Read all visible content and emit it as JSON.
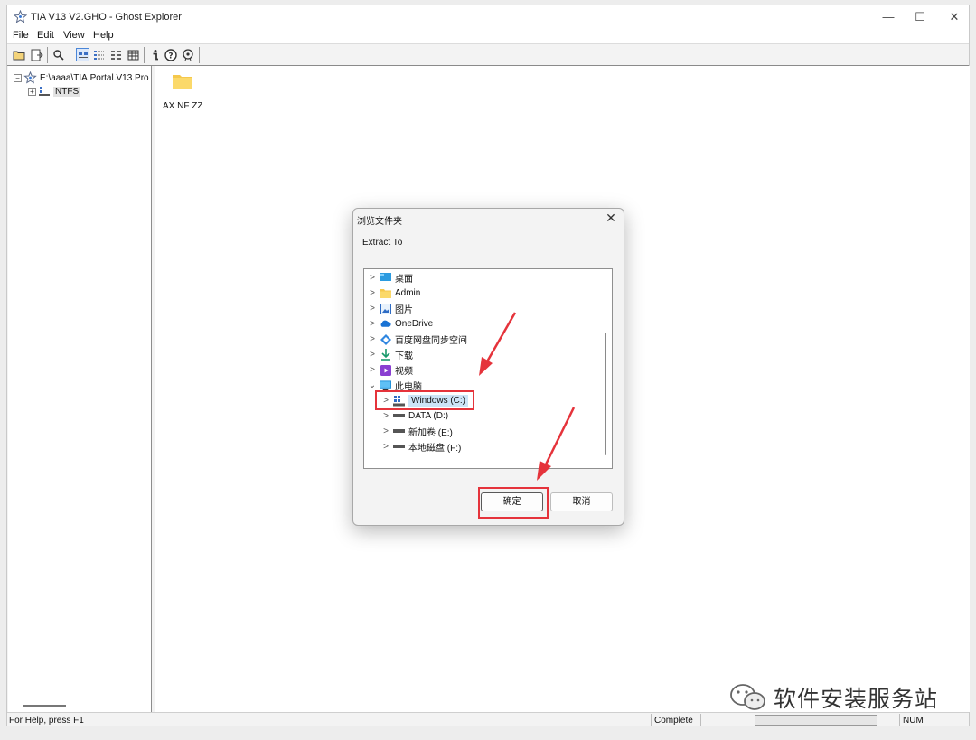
{
  "window": {
    "title": "TIA V13 V2.GHO - Ghost Explorer",
    "minimize_glyph": "—",
    "maximize_glyph": "☐",
    "close_glyph": "✕"
  },
  "menu": [
    {
      "label": "File"
    },
    {
      "label": "Edit"
    },
    {
      "label": "View"
    },
    {
      "label": "Help"
    }
  ],
  "toolbar": {
    "icons": [
      "open-folder-icon",
      "extract-icon",
      "find-icon",
      "large-icons-icon",
      "small-icons-icon",
      "list-icon",
      "details-icon",
      "info-icon",
      "help-icon",
      "about-icon"
    ]
  },
  "tree": {
    "root_label": "E:\\aaaa\\TIA.Portal.V13.Pro",
    "root_expander": "−",
    "child_label": "NTFS",
    "child_expander": "+"
  },
  "files": [
    {
      "name": "AX NF ZZ"
    }
  ],
  "status": {
    "help": "For Help, press F1",
    "state": "Complete",
    "num": "NUM"
  },
  "dialog": {
    "title": "浏览文件夹",
    "close_glyph": "✕",
    "prompt": "Extract To",
    "items": [
      {
        "label": "桌面",
        "chevron": ">",
        "icon": "desktop-icon"
      },
      {
        "label": "Admin",
        "chevron": ">",
        "icon": "user-folder-icon"
      },
      {
        "label": "图片",
        "chevron": ">",
        "icon": "pictures-icon"
      },
      {
        "label": "OneDrive",
        "chevron": ">",
        "icon": "onedrive-icon"
      },
      {
        "label": "百度网盘同步空间",
        "chevron": ">",
        "icon": "baidu-netdisk-icon"
      },
      {
        "label": "下载",
        "chevron": ">",
        "icon": "download-icon"
      },
      {
        "label": "视频",
        "chevron": ">",
        "icon": "video-icon"
      },
      {
        "label": "此电脑",
        "chevron": "⌄",
        "icon": "this-pc-icon"
      },
      {
        "label": "Windows (C:)",
        "chevron": ">",
        "icon": "windows-drive-icon",
        "selected": true
      },
      {
        "label": "DATA (D:)",
        "chevron": ">",
        "icon": "drive-icon"
      },
      {
        "label": "新加卷 (E:)",
        "chevron": ">",
        "icon": "drive-icon"
      },
      {
        "label": "本地磁盘 (F:)",
        "chevron": ">",
        "icon": "drive-icon"
      }
    ],
    "ok_label": "确定",
    "cancel_label": "取消"
  },
  "watermark": {
    "text": "软件安装服务站"
  },
  "colors": {
    "highlight_red": "#e5333b",
    "selection_blue": "#cce4f7",
    "folder_yellow": "#f5c84c"
  }
}
